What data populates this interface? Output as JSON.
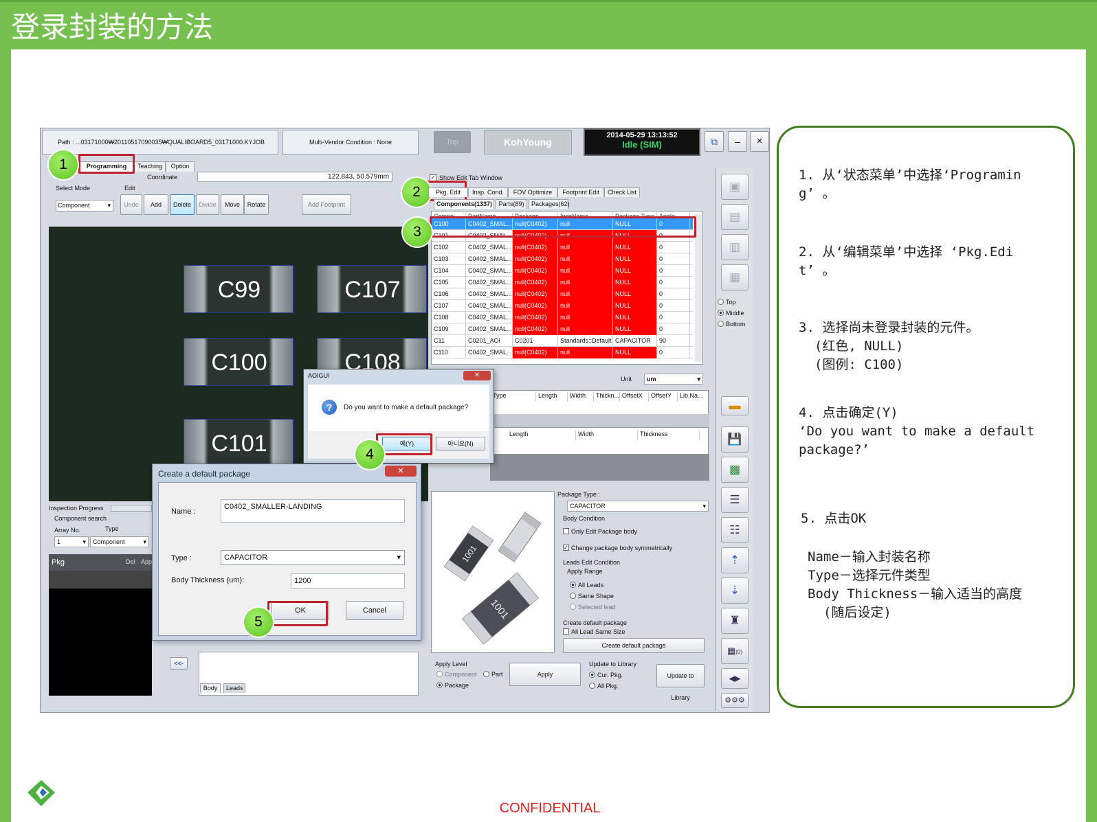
{
  "slide": {
    "title": "登录封装的方法",
    "footer": "CONFIDENTIAL"
  },
  "colors": {
    "green": "#75c04f",
    "frame": "#3f7f1d",
    "callout": "#c0232e",
    "null_row": "#ff0000",
    "selected": "#3399ff"
  },
  "app": {
    "path": "Path : ...03171000₩20110517090035₩QUALIBOARD5_03171000.KYJOB",
    "vendor": "Multi-Vendor Condition : None",
    "top_btn": "Top",
    "brand": "KohYoung",
    "datetime": "2014-05-29 13:13:52",
    "status": "Idle (SIM)",
    "min_label": "–",
    "close_label": "×",
    "tabs": [
      "Programming",
      "Teaching",
      "Option"
    ],
    "coordinate_label": "Coordinate",
    "coordinate_value": "122.843, 50.579mm",
    "select_mode_label": "Select Mode",
    "select_mode_value": "Component",
    "edit_label": "Edit",
    "edit_buttons": [
      "Undo",
      "Add",
      "Delete",
      "Divide",
      "Move",
      "Rotate"
    ],
    "add_footprint": "Add Footprint",
    "show_edit": "Show Edit Tab Window",
    "right_tabs": [
      "Pkg. Edit",
      "Insp. Cond.",
      "FOV Optimize",
      "Footprint Edit",
      "Check List"
    ],
    "sub_tabs": [
      "Components(1337)",
      "Parts(89)",
      "Packages(62)"
    ],
    "columns": [
      "Compo...",
      "PartName",
      "Package",
      "InspName",
      "Package Type",
      "Angle"
    ],
    "rows": [
      {
        "c": [
          "C100",
          "C0402_SMAL...",
          "null(C0402)",
          "null",
          "NULL",
          "0"
        ],
        "st": "selected"
      },
      {
        "c": [
          "C101",
          "C0402_SMAL...",
          "null(C0402)",
          "null",
          "NULL",
          "0"
        ],
        "st": "null"
      },
      {
        "c": [
          "C102",
          "C0402_SMAL...",
          "null(C0402)",
          "null",
          "NULL",
          "0"
        ],
        "st": "null"
      },
      {
        "c": [
          "C103",
          "C0402_SMAL...",
          "null(C0402)",
          "null",
          "NULL",
          "0"
        ],
        "st": "null"
      },
      {
        "c": [
          "C104",
          "C0402_SMAL...",
          "null(C0402)",
          "null",
          "NULL",
          "0"
        ],
        "st": "null"
      },
      {
        "c": [
          "C105",
          "C0402_SMAL...",
          "null(C0402)",
          "null",
          "NULL",
          "0"
        ],
        "st": "null"
      },
      {
        "c": [
          "C106",
          "C0402_SMAL...",
          "null(C0402)",
          "null",
          "NULL",
          "0"
        ],
        "st": "null"
      },
      {
        "c": [
          "C107",
          "C0402_SMAL...",
          "null(C0402)",
          "null",
          "NULL",
          "0"
        ],
        "st": "null"
      },
      {
        "c": [
          "C108",
          "C0402_SMAL...",
          "null(C0402)",
          "null",
          "NULL",
          "0"
        ],
        "st": "null"
      },
      {
        "c": [
          "C109",
          "C0402_SMAL...",
          "null(C0402)",
          "null",
          "NULL",
          "0"
        ],
        "st": "null"
      },
      {
        "c": [
          "C11",
          "C0201_AOI",
          "C0201",
          "Standards::Default",
          "CAPACITOR",
          "90"
        ],
        "st": "ok"
      },
      {
        "c": [
          "C110",
          "C0402_SMAL...",
          "null(C0402)",
          "null",
          "NULL",
          "0"
        ],
        "st": "null"
      }
    ],
    "unit_label": "Unit",
    "unit_value": "um",
    "lead_columns": [
      "Type",
      "Length",
      "Width",
      "Thickn...",
      "OffsetX",
      "OffsetY",
      "Lib.Na..."
    ],
    "body_columns": [
      "Length",
      "Width",
      "Thickness"
    ],
    "components": [
      "C99",
      "C107",
      "C100",
      "C108",
      "C101"
    ],
    "inspection_progress": "Inspection Progress",
    "component_search": "Component search",
    "array_no_label": "Array No.",
    "array_no_value": "1",
    "type_label": "Type",
    "type_value": "Component",
    "pkg_label": "Pkg",
    "del_label": "Del",
    "app_label": "App",
    "nav_back": "<<-",
    "bottom_tabs": [
      "Body",
      "Leads"
    ],
    "package_type_label": "Package Type :",
    "package_type_value": "CAPACITOR",
    "body_condition": "Body Condition",
    "only_edit_body": "Only Edit Package body",
    "change_symmetric": "Change package body symmetrically",
    "leads_edit_condition": "Leads Edit Condition",
    "apply_range": "Apply Range",
    "all_leads": "All Leads",
    "same_shape": "Same Shape",
    "selected_lead": "Selected lead",
    "create_default_package_label": "Create default package",
    "all_lead_same_size": "All Lead Same Size",
    "create_default_package_btn": "Create default package",
    "apply_level": "Apply Level",
    "level_options": [
      "Component",
      "Part",
      "Package"
    ],
    "apply_btn": "Apply",
    "update_to_library_label": "Update to Library",
    "update_options": [
      "Cur. Pkg.",
      "All Pkg."
    ],
    "update_btn": "Update to Library",
    "views": [
      "Top",
      "Middle",
      "Bottom"
    ],
    "chip_marks": [
      "1001",
      "1001",
      "1001"
    ],
    "side_count": "(0)"
  },
  "dialog_aoigui": {
    "title": "AOIGUI",
    "message": "Do you want to make a default package?",
    "yes": "예(Y)",
    "no": "아니요(N)"
  },
  "dialog_create": {
    "title": "Create a default package",
    "name_label": "Name :",
    "name_value": "C0402_SMALLER-LANDING",
    "type_label": "Type :",
    "type_value": "CAPACITOR",
    "thickness_label": "Body Thickness (um):",
    "thickness_value": "1200",
    "ok": "OK",
    "cancel": "Cancel"
  },
  "badges": [
    "1",
    "2",
    "3",
    "4",
    "5"
  ],
  "notes": [
    {
      "text": "1. 从‘状态菜单’中选择‘Programin\ng’ 。"
    },
    {
      "text": "2. 从‘编辑菜单’中选择 ‘Pkg.Edi\nt’ 。"
    },
    {
      "text": "3. 选择尚未登录封装的元件。\n  (红色, NULL)\n  (图例: C100)"
    },
    {
      "text": "4. 点击确定(Y)\n‘Do you want to make a default\npackage?’"
    },
    {
      "text": "5. 点击OK"
    },
    {
      "text": "Name－输入封装名称\nType－选择元件类型\nBody Thickness－输入适当的高度\n  (随后设定)"
    }
  ]
}
